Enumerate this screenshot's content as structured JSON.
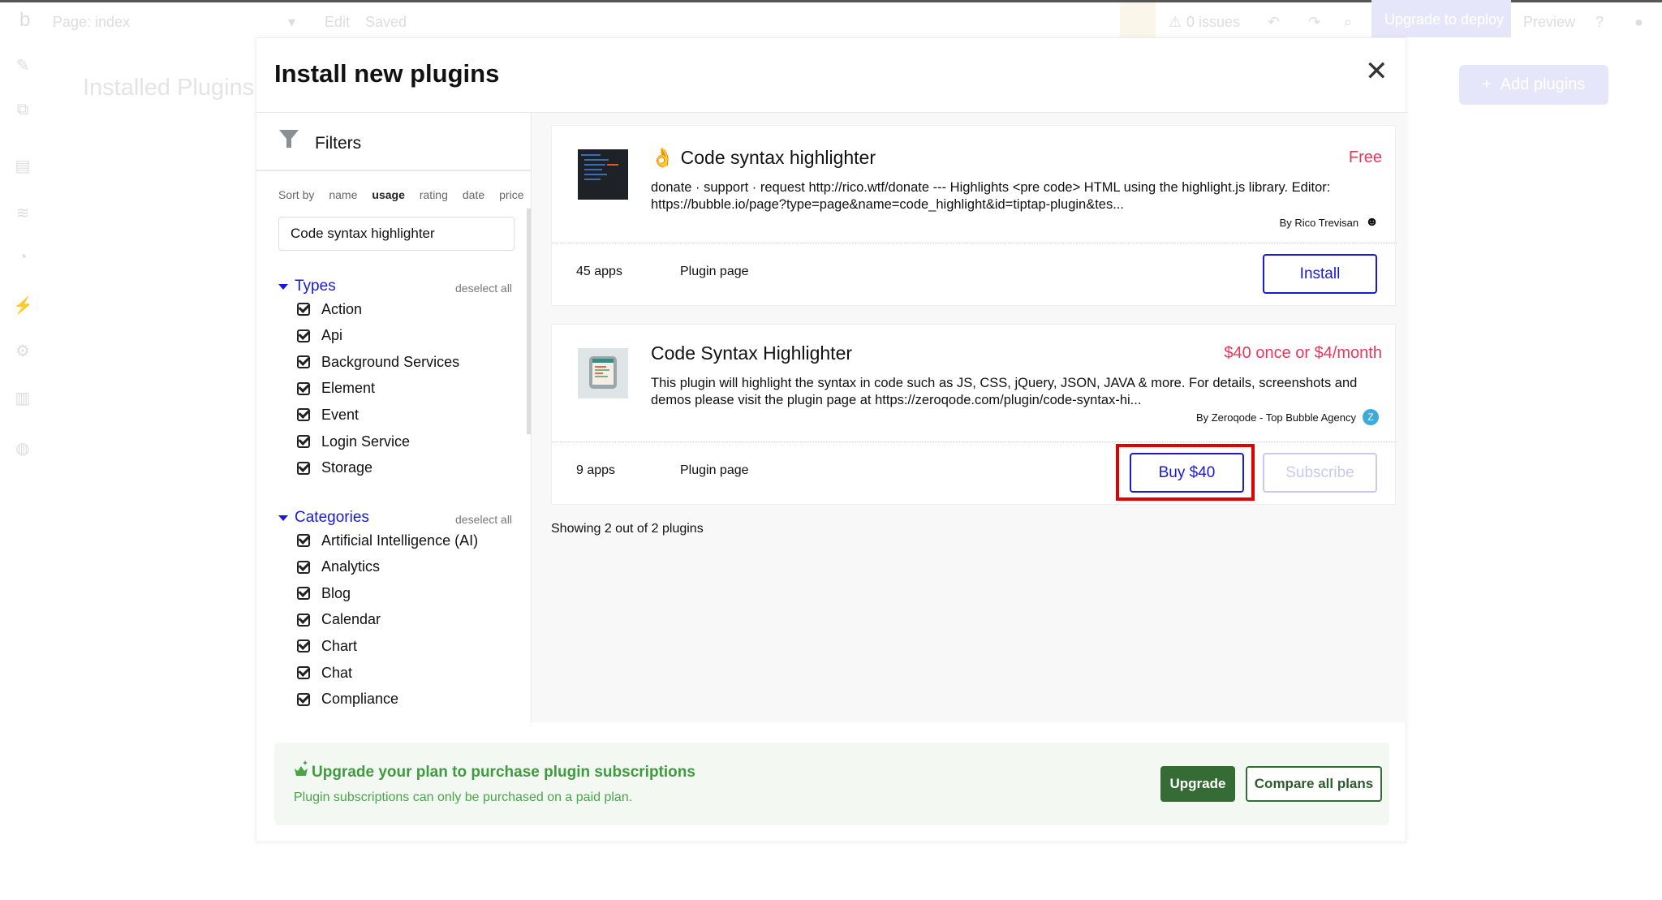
{
  "topbar": {
    "page": "Page: index",
    "edit": "Edit",
    "saved": "Saved",
    "issues": "0 issues",
    "upgrade_deploy": "Upgrade to deploy",
    "preview": "Preview"
  },
  "background": {
    "title": "Installed Plugins",
    "add_button": "Add plugins"
  },
  "modal": {
    "title": "Install new plugins",
    "filters": {
      "title": "Filters",
      "sort_label": "Sort by",
      "sort_options": [
        "name",
        "usage",
        "rating",
        "date",
        "price"
      ],
      "sort_selected": "usage",
      "search_value": "Code syntax highlighter",
      "types": {
        "label": "Types",
        "deselect": "deselect all",
        "items": [
          "Action",
          "Api",
          "Background Services",
          "Element",
          "Event",
          "Login Service",
          "Storage"
        ]
      },
      "categories": {
        "label": "Categories",
        "deselect": "deselect all",
        "items": [
          "Artificial Intelligence (AI)",
          "Analytics",
          "Blog",
          "Calendar",
          "Chart",
          "Chat",
          "Compliance"
        ]
      }
    },
    "plugins": [
      {
        "name": "Code syntax highlighter",
        "price": "Free",
        "description": "donate · support · request http://rico.wtf/donate --- Highlights <pre code> HTML using the highlight.js library. Editor: https://bubble.io/page?type=page&name=code_highlight&id=tiptap-plugin&tes...",
        "author": "By Rico Trevisan",
        "apps": "45 apps",
        "plugin_page": "Plugin page",
        "install": "Install"
      },
      {
        "name": "Code Syntax Highlighter",
        "price": "$40 once or $4/month",
        "description": "This plugin will highlight the syntax in code such as JS, CSS, jQuery, JSON, JAVA & more. For details, screenshots and demos please visit the plugin page at https://zeroqode.com/plugin/code-syntax-hi...",
        "author": "By Zeroqode - Top Bubble Agency",
        "apps": "9 apps",
        "plugin_page": "Plugin page",
        "buy": "Buy $40",
        "subscribe": "Subscribe"
      }
    ],
    "showing": "Showing 2 out of 2 plugins",
    "banner": {
      "title": "Upgrade your plan to purchase plugin subscriptions",
      "subtitle": "Plugin subscriptions can only be purchased on a paid plan.",
      "upgrade": "Upgrade",
      "compare": "Compare all plans"
    }
  },
  "colors": {
    "accent": "#1a1ad6",
    "price": "#e8375a",
    "green": "#356b35",
    "highlight": "#e00000"
  }
}
